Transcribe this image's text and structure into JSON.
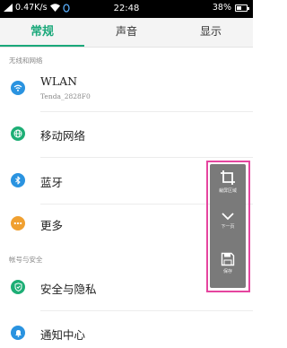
{
  "status_bar": {
    "speed": "0.47K/s",
    "time": "22:48",
    "battery": "38%",
    "battery_level": 0.38
  },
  "tabs": [
    {
      "label": "常规",
      "active": true
    },
    {
      "label": "声音",
      "active": false
    },
    {
      "label": "显示",
      "active": false
    }
  ],
  "sections": {
    "wireless": "无线和网络",
    "account": "帐号与安全"
  },
  "items": {
    "wlan": {
      "title": "WLAN",
      "subtitle": "Tenda_2828F0",
      "icon": "wifi-icon",
      "color": "#2a93e0"
    },
    "mobile": {
      "title": "移动网络",
      "icon": "globe-icon",
      "color": "#1dae75"
    },
    "bluetooth": {
      "title": "蓝牙",
      "icon": "bluetooth-icon",
      "color": "#2a93e0"
    },
    "more": {
      "title": "更多",
      "icon": "more-icon",
      "color": "#f0a030"
    },
    "security": {
      "title": "安全与隐私",
      "icon": "shield-icon",
      "color": "#1dae75"
    },
    "notifications": {
      "title": "通知中心",
      "icon": "bell-icon",
      "color": "#2a93e0"
    }
  },
  "floating_toolbar": {
    "crop_label": "裁屏区域",
    "next_label": "下一页",
    "save_label": "保存"
  }
}
